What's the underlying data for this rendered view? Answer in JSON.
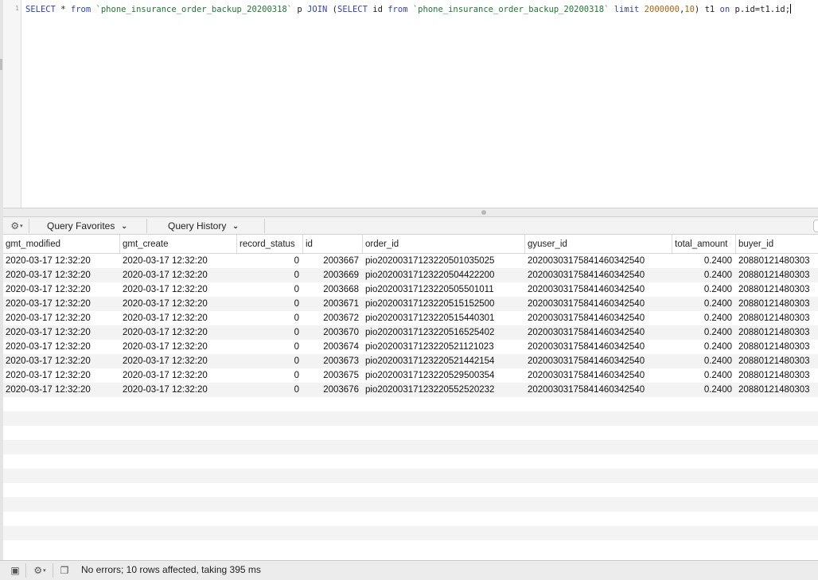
{
  "editor": {
    "line_number": "1",
    "query_tokens": [
      {
        "t": "SELECT",
        "c": "kw"
      },
      {
        "t": " * ",
        "c": ""
      },
      {
        "t": "from",
        "c": "kw"
      },
      {
        "t": " ",
        "c": ""
      },
      {
        "t": "`phone_insurance_order_backup_20200318`",
        "c": "bt"
      },
      {
        "t": " p ",
        "c": ""
      },
      {
        "t": "JOIN",
        "c": "kw"
      },
      {
        "t": " (",
        "c": ""
      },
      {
        "t": "SELECT",
        "c": "kw"
      },
      {
        "t": " id ",
        "c": ""
      },
      {
        "t": "from",
        "c": "kw"
      },
      {
        "t": " ",
        "c": ""
      },
      {
        "t": "`phone_insurance_order_backup_20200318`",
        "c": "bt"
      },
      {
        "t": " ",
        "c": ""
      },
      {
        "t": "limit",
        "c": "kw"
      },
      {
        "t": " ",
        "c": ""
      },
      {
        "t": "2000000",
        "c": "num"
      },
      {
        "t": ",",
        "c": ""
      },
      {
        "t": "10",
        "c": "num"
      },
      {
        "t": ") t1 ",
        "c": ""
      },
      {
        "t": "on",
        "c": "kw"
      },
      {
        "t": " p.id=t1.id;",
        "c": ""
      }
    ]
  },
  "toolbar": {
    "query_favorites": "Query Favorites",
    "query_history": "Query History"
  },
  "table": {
    "columns": [
      "gmt_modified",
      "gmt_create",
      "record_status",
      "id",
      "order_id",
      "gyuser_id",
      "total_amount",
      "buyer_id"
    ],
    "rows": [
      [
        "2020-03-17 12:32:20",
        "2020-03-17 12:32:20",
        "0",
        "2003667",
        "pio20200317123220501035025",
        "202003031758414603425​40",
        "0.2400",
        "20880121480303"
      ],
      [
        "2020-03-17 12:32:20",
        "2020-03-17 12:32:20",
        "0",
        "2003669",
        "pio20200317123220504422200",
        "20200303175841460342540",
        "0.2400",
        "20880121480303"
      ],
      [
        "2020-03-17 12:32:20",
        "2020-03-17 12:32:20",
        "0",
        "2003668",
        "pio20200317123220505501011",
        "20200303175841460342540",
        "0.2400",
        "20880121480303"
      ],
      [
        "2020-03-17 12:32:20",
        "2020-03-17 12:32:20",
        "0",
        "2003671",
        "pio20200317123220515152500",
        "20200303175841460342540",
        "0.2400",
        "20880121480303"
      ],
      [
        "2020-03-17 12:32:20",
        "2020-03-17 12:32:20",
        "0",
        "2003672",
        "pio20200317123220515440301",
        "20200303175841460342540",
        "0.2400",
        "20880121480303"
      ],
      [
        "2020-03-17 12:32:20",
        "2020-03-17 12:32:20",
        "0",
        "2003670",
        "pio20200317123220516525402",
        "20200303175841460342540",
        "0.2400",
        "20880121480303"
      ],
      [
        "2020-03-17 12:32:20",
        "2020-03-17 12:32:20",
        "0",
        "2003674",
        "pio20200317123220521121023",
        "20200303175841460342540",
        "0.2400",
        "20880121480303"
      ],
      [
        "2020-03-17 12:32:20",
        "2020-03-17 12:32:20",
        "0",
        "2003673",
        "pio20200317123220521442154",
        "20200303175841460342540",
        "0.2400",
        "20880121480303"
      ],
      [
        "2020-03-17 12:32:20",
        "2020-03-17 12:32:20",
        "0",
        "2003675",
        "pio20200317123220529500354",
        "20200303175841460342540",
        "0.2400",
        "20880121480303"
      ],
      [
        "2020-03-17 12:32:20",
        "2020-03-17 12:32:20",
        "0",
        "2003676",
        "pio20200317123220552520232",
        "20200303175841460342540",
        "0.2400",
        "20880121480303"
      ]
    ]
  },
  "icons": {
    "gear": "⚙",
    "caret_down": "▾",
    "chevron_down": "⌄",
    "image": "▣",
    "copy": "❐"
  },
  "status": {
    "message": "No errors; 10 rows affected, taking 395 ms"
  }
}
